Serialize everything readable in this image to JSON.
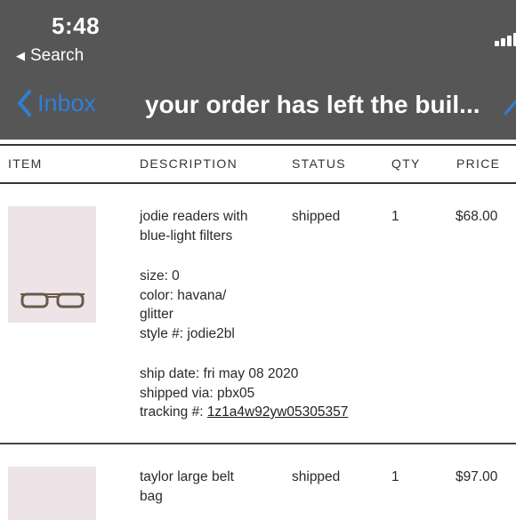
{
  "status_bar": {
    "time": "5:48",
    "back_app_label": "Search"
  },
  "nav": {
    "back_label": "Inbox",
    "title": "your order has left the buil..."
  },
  "table": {
    "headers": {
      "item": "ITEM",
      "description": "DESCRIPTION",
      "status": "STATUS",
      "qty": "QTY",
      "price": "PRICE"
    },
    "rows": [
      {
        "name_lines": [
          "jodie readers with",
          "blue-light filters"
        ],
        "size": "size: 0",
        "color_lines": [
          "color: havana/",
          "glitter"
        ],
        "style": "style #: jodie2bl",
        "ship_date": "ship date: fri may 08 2020",
        "shipped_via": "shipped via: pbx05",
        "tracking_label": "tracking #: ",
        "tracking_number": "1z1a4w92yw05305357",
        "status": "shipped",
        "qty": "1",
        "price": "$68.00",
        "image_icon": "eyeglasses-icon"
      },
      {
        "name_lines": [
          "taylor large belt",
          "bag"
        ],
        "status": "shipped",
        "qty": "1",
        "price": "$97.00"
      }
    ]
  },
  "colors": {
    "header_bg": "#565656",
    "accent_blue": "#2f7fd6",
    "thumb_bg": "#eee3e6"
  }
}
